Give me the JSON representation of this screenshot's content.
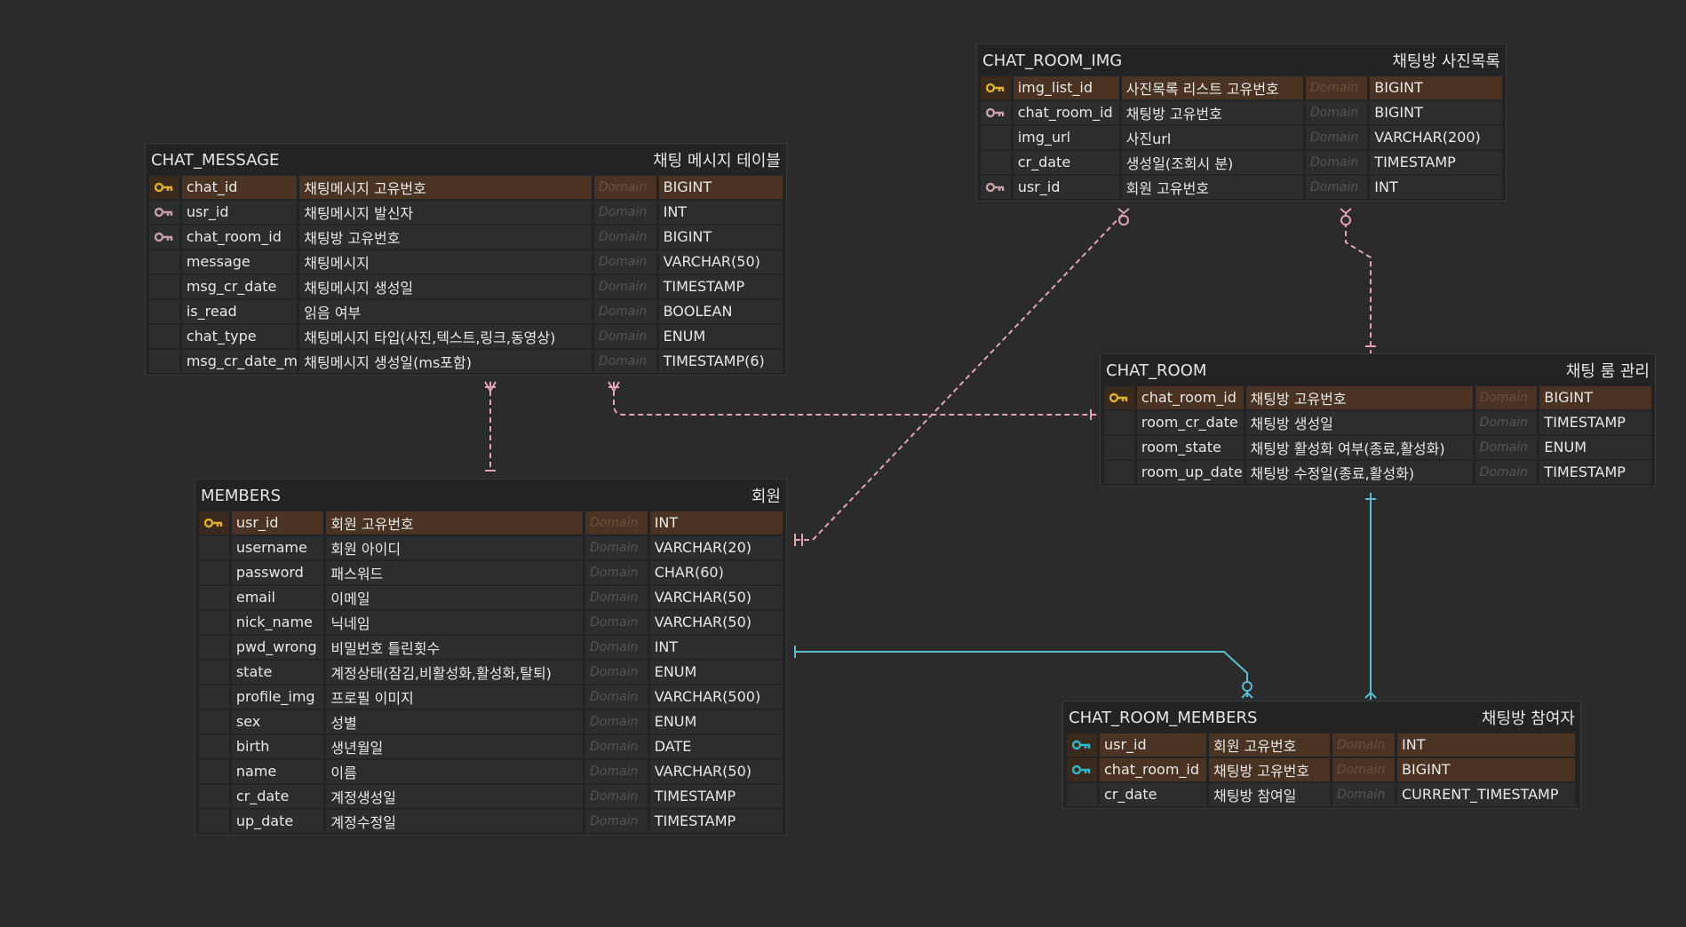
{
  "colors": {
    "background": "#2b2b2b",
    "pk_row": "#4a3322",
    "pk_key": "#e0b12c",
    "fk_key": "#c9a0aa",
    "pfk_key": "#2fb9c9",
    "link_pink": "#e4a2b7",
    "link_cyan": "#5bbcd1"
  },
  "tables": [
    {
      "id": "chat_message",
      "name": "CHAT_MESSAGE",
      "comment": "채팅 메시지 테이블",
      "columns": [
        {
          "key": "pk",
          "name": "chat_id",
          "comment": "채팅메시지 고유번호",
          "domain": "Domain",
          "type": "BIGINT"
        },
        {
          "key": "fk",
          "name": "usr_id",
          "comment": "채팅메시지 발신자",
          "domain": "Domain",
          "type": "INT"
        },
        {
          "key": "fk",
          "name": "chat_room_id",
          "comment": "채팅방 고유번호",
          "domain": "Domain",
          "type": "BIGINT"
        },
        {
          "key": "",
          "name": "message",
          "comment": "채팅메시지",
          "domain": "Domain",
          "type": "VARCHAR(50)"
        },
        {
          "key": "",
          "name": "msg_cr_date",
          "comment": "채팅메시지 생성일",
          "domain": "Domain",
          "type": "TIMESTAMP"
        },
        {
          "key": "",
          "name": "is_read",
          "comment": "읽음 여부",
          "domain": "Domain",
          "type": "BOOLEAN"
        },
        {
          "key": "",
          "name": "chat_type",
          "comment": "채팅메시지 타입(사진,텍스트,링크,동영상)",
          "domain": "Domain",
          "type": "ENUM"
        },
        {
          "key": "",
          "name": "msg_cr_date_ms",
          "comment": "채팅메시지 생성일(ms포함)",
          "domain": "Domain",
          "type": "TIMESTAMP(6)"
        }
      ]
    },
    {
      "id": "members",
      "name": "MEMBERS",
      "comment": "회원",
      "columns": [
        {
          "key": "pk",
          "name": "usr_id",
          "comment": "회원 고유번호",
          "domain": "Domain",
          "type": "INT"
        },
        {
          "key": "",
          "name": "username",
          "comment": "회원 아이디",
          "domain": "Domain",
          "type": "VARCHAR(20)"
        },
        {
          "key": "",
          "name": "password",
          "comment": "패스워드",
          "domain": "Domain",
          "type": "CHAR(60)"
        },
        {
          "key": "",
          "name": "email",
          "comment": "이메일",
          "domain": "Domain",
          "type": "VARCHAR(50)"
        },
        {
          "key": "",
          "name": "nick_name",
          "comment": "닉네임",
          "domain": "Domain",
          "type": "VARCHAR(50)"
        },
        {
          "key": "",
          "name": "pwd_wrong",
          "comment": "비밀번호 틀린횟수",
          "domain": "Domain",
          "type": "INT"
        },
        {
          "key": "",
          "name": "state",
          "comment": "계정상태(잠김,비활성화,활성화,탈퇴)",
          "domain": "Domain",
          "type": "ENUM"
        },
        {
          "key": "",
          "name": "profile_img",
          "comment": "프로필 이미지",
          "domain": "Domain",
          "type": "VARCHAR(500)"
        },
        {
          "key": "",
          "name": "sex",
          "comment": "성별",
          "domain": "Domain",
          "type": "ENUM"
        },
        {
          "key": "",
          "name": "birth",
          "comment": "생년월일",
          "domain": "Domain",
          "type": "DATE"
        },
        {
          "key": "",
          "name": "name",
          "comment": "이름",
          "domain": "Domain",
          "type": "VARCHAR(50)"
        },
        {
          "key": "",
          "name": "cr_date",
          "comment": "계정생성일",
          "domain": "Domain",
          "type": "TIMESTAMP"
        },
        {
          "key": "",
          "name": "up_date",
          "comment": "계정수정일",
          "domain": "Domain",
          "type": "TIMESTAMP"
        }
      ]
    },
    {
      "id": "chat_room_img",
      "name": "CHAT_ROOM_IMG",
      "comment": "채팅방 사진목록",
      "columns": [
        {
          "key": "pk",
          "name": "img_list_id",
          "comment": "사진목록 리스트 고유번호",
          "domain": "Domain",
          "type": "BIGINT"
        },
        {
          "key": "fk",
          "name": "chat_room_id",
          "comment": "채팅방 고유번호",
          "domain": "Domain",
          "type": "BIGINT"
        },
        {
          "key": "",
          "name": "img_url",
          "comment": "사진url",
          "domain": "Domain",
          "type": "VARCHAR(200)"
        },
        {
          "key": "",
          "name": "cr_date",
          "comment": "생성일(조회시 분)",
          "domain": "Domain",
          "type": "TIMESTAMP"
        },
        {
          "key": "fk",
          "name": "usr_id",
          "comment": "회원 고유번호",
          "domain": "Domain",
          "type": "INT"
        }
      ]
    },
    {
      "id": "chat_room",
      "name": "CHAT_ROOM",
      "comment": "채팅 룸 관리",
      "columns": [
        {
          "key": "pk",
          "name": "chat_room_id",
          "comment": "채팅방 고유번호",
          "domain": "Domain",
          "type": "BIGINT"
        },
        {
          "key": "",
          "name": "room_cr_date",
          "comment": "채팅방 생성일",
          "domain": "Domain",
          "type": "TIMESTAMP"
        },
        {
          "key": "",
          "name": "room_state",
          "comment": "채팅방 활성화 여부(종료,활성화)",
          "domain": "Domain",
          "type": "ENUM"
        },
        {
          "key": "",
          "name": "room_up_date",
          "comment": "채팅방 수정일(종료,활성화)",
          "domain": "Domain",
          "type": "TIMESTAMP"
        }
      ]
    },
    {
      "id": "chat_room_members",
      "name": "CHAT_ROOM_MEMBERS",
      "comment": "채팅방 참여자",
      "columns": [
        {
          "key": "pfk",
          "name": "usr_id",
          "comment": "회원 고유번호",
          "domain": "Domain",
          "type": "INT"
        },
        {
          "key": "pfk",
          "name": "chat_room_id",
          "comment": "채팅방 고유번호",
          "domain": "Domain",
          "type": "BIGINT"
        },
        {
          "key": "",
          "name": "cr_date",
          "comment": "채팅방 참여일",
          "domain": "Domain",
          "type": "CURRENT_TIMESTAMP"
        }
      ]
    }
  ]
}
